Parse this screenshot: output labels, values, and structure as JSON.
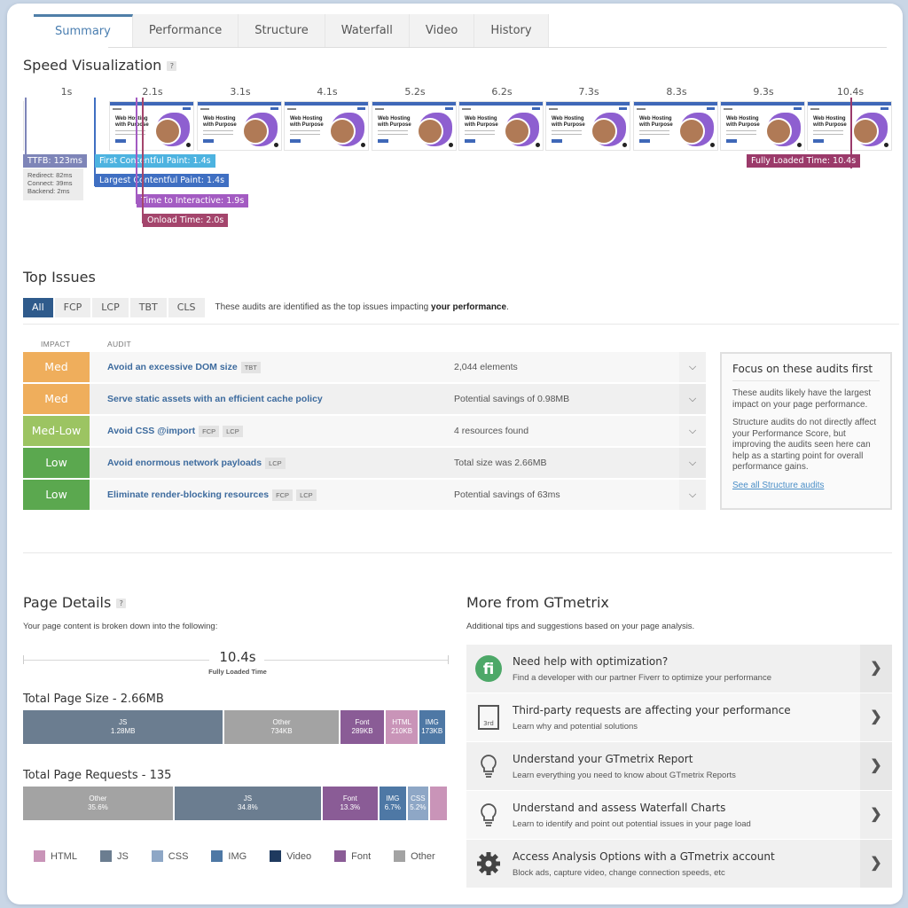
{
  "tabs": [
    {
      "label": "Summary",
      "active": true
    },
    {
      "label": "Performance",
      "active": false
    },
    {
      "label": "Structure",
      "active": false
    },
    {
      "label": "Waterfall",
      "active": false
    },
    {
      "label": "Video",
      "active": false
    },
    {
      "label": "History",
      "active": false
    }
  ],
  "speed_visualization": {
    "title": "Speed Visualization",
    "help": "?",
    "frame_times": [
      "1s",
      "2.1s",
      "3.1s",
      "4.1s",
      "5.2s",
      "6.2s",
      "7.3s",
      "8.3s",
      "9.3s",
      "10.4s"
    ],
    "thumbnail_heading": "Web Hosting with Purpose",
    "ttfb": {
      "label": "TTFB: 123ms",
      "details": [
        "Redirect: 82ms",
        "Connect: 39ms",
        "Backend: 2ms"
      ]
    },
    "markers": [
      {
        "label": "First Contentful Paint: 1.4s",
        "color": "#4db3e0"
      },
      {
        "label": "Largest Contentful Paint: 1.4s",
        "color": "#3f6fc2"
      },
      {
        "label": "Time to Interactive: 1.9s",
        "color": "#a35bc2"
      },
      {
        "label": "Onload Time: 2.0s",
        "color": "#a4456c"
      },
      {
        "label": "Fully Loaded Time: 10.4s",
        "color": "#9b3a6a"
      }
    ],
    "ttfb_color": "#7e85b8"
  },
  "top_issues": {
    "title": "Top Issues",
    "filters": [
      {
        "label": "All",
        "active": true
      },
      {
        "label": "FCP",
        "active": false
      },
      {
        "label": "LCP",
        "active": false
      },
      {
        "label": "TBT",
        "active": false
      },
      {
        "label": "CLS",
        "active": false
      }
    ],
    "description_prefix": "These audits are identified as the top issues impacting ",
    "description_bold": "your performance",
    "description_suffix": ".",
    "columns": {
      "impact": "IMPACT",
      "audit": "AUDIT"
    },
    "audits": [
      {
        "impact": "Med",
        "color": "#efae5c",
        "title": "Avoid an excessive DOM size",
        "tags": [
          "TBT"
        ],
        "value": "2,044 elements"
      },
      {
        "impact": "Med",
        "color": "#efae5c",
        "title": "Serve static assets with an efficient cache policy",
        "tags": [],
        "value": "Potential savings of 0.98MB"
      },
      {
        "impact": "Med-Low",
        "color": "#9cc462",
        "title": "Avoid CSS @import",
        "tags": [
          "FCP",
          "LCP"
        ],
        "value": "4 resources found"
      },
      {
        "impact": "Low",
        "color": "#5ba84f",
        "title": "Avoid enormous network payloads",
        "tags": [
          "LCP"
        ],
        "value": "Total size was 2.66MB"
      },
      {
        "impact": "Low",
        "color": "#5ba84f",
        "title": "Eliminate render-blocking resources",
        "tags": [
          "FCP",
          "LCP"
        ],
        "value": "Potential savings of 63ms"
      }
    ],
    "focus": {
      "title": "Focus on these audits first",
      "p1": "These audits likely have the largest impact on your page performance.",
      "p2": "Structure audits do not directly affect your Performance Score, but improving the audits seen here can help as a starting point for overall performance gains.",
      "link": "See all Structure audits"
    }
  },
  "page_details": {
    "title": "Page Details",
    "help": "?",
    "subtitle": "Your page content is broken down into the following:",
    "fully_loaded_value": "10.4s",
    "fully_loaded_label": "Fully Loaded Time",
    "size_title": "Total Page Size - 2.66MB",
    "size_segments": [
      {
        "type": "JS",
        "value": "1.28MB",
        "share": 0.48,
        "color": "#6b7d90"
      },
      {
        "type": "Other",
        "value": "734KB",
        "share": 0.275,
        "color": "#a3a3a3"
      },
      {
        "type": "Font",
        "value": "289KB",
        "share": 0.109,
        "color": "#8a5c96"
      },
      {
        "type": "HTML",
        "value": "210KB",
        "share": 0.079,
        "color": "#c994b8"
      },
      {
        "type": "IMG",
        "value": "173KB",
        "share": 0.065,
        "color": "#4e78a5"
      },
      {
        "type": "CSS",
        "value": "",
        "share": 0.005,
        "color": "#8ea7c6"
      }
    ],
    "requests_title": "Total Page Requests - 135",
    "request_segments": [
      {
        "type": "Other",
        "value": "35.6%",
        "share": 0.356,
        "color": "#a3a3a3"
      },
      {
        "type": "JS",
        "value": "34.8%",
        "share": 0.348,
        "color": "#6b7d90"
      },
      {
        "type": "Font",
        "value": "13.3%",
        "share": 0.133,
        "color": "#8a5c96"
      },
      {
        "type": "IMG",
        "value": "6.7%",
        "share": 0.067,
        "color": "#4e78a5"
      },
      {
        "type": "CSS",
        "value": "5.2%",
        "share": 0.052,
        "color": "#8ea7c6"
      },
      {
        "type": "HTML",
        "value": "",
        "share": 0.044,
        "color": "#c994b8"
      }
    ],
    "legend": [
      {
        "label": "HTML",
        "color": "#c994b8"
      },
      {
        "label": "JS",
        "color": "#6b7d90"
      },
      {
        "label": "CSS",
        "color": "#8ea7c6"
      },
      {
        "label": "IMG",
        "color": "#4e78a5"
      },
      {
        "label": "Video",
        "color": "#1f3a5f"
      },
      {
        "label": "Font",
        "color": "#8a5c96"
      },
      {
        "label": "Other",
        "color": "#a3a3a3"
      }
    ]
  },
  "more": {
    "title": "More from GTmetrix",
    "subtitle": "Additional tips and suggestions based on your page analysis.",
    "items": [
      {
        "icon": "fiverr-icon",
        "title": "Need help with optimization?",
        "sub": "Find a developer with our partner Fiverr to optimize your performance"
      },
      {
        "icon": "third-party-icon",
        "title": "Third-party requests are affecting your performance",
        "sub": "Learn why and potential solutions",
        "icon_text": "3rd"
      },
      {
        "icon": "lightbulb-icon",
        "title": "Understand your GTmetrix Report",
        "sub": "Learn everything you need to know about GTmetrix Reports"
      },
      {
        "icon": "lightbulb-icon",
        "title": "Understand and assess Waterfall Charts",
        "sub": "Learn to identify and point out potential issues in your page load"
      },
      {
        "icon": "gear-icon",
        "title": "Access Analysis Options with a GTmetrix account",
        "sub": "Block ads, capture video, change connection speeds, etc"
      }
    ]
  }
}
